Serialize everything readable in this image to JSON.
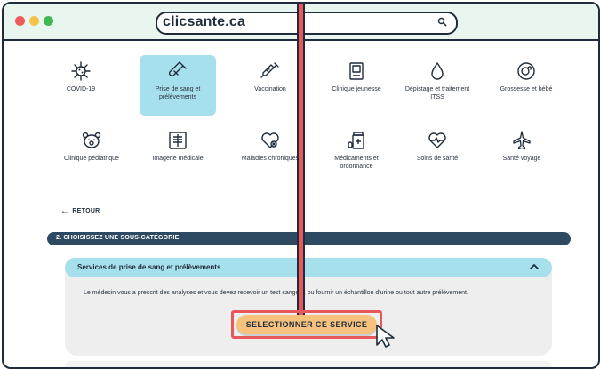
{
  "browser": {
    "url": "clicsante.ca"
  },
  "categories": [
    {
      "label": "COVID-19",
      "icon": "virus-icon"
    },
    {
      "label": "Prise de sang et prélèvements",
      "icon": "test-tube-icon",
      "selected": true
    },
    {
      "label": "Vaccination",
      "icon": "syringe-icon"
    },
    {
      "label": "Clinique jeunesse",
      "icon": "clipboard-icon"
    },
    {
      "label": "Dépistage et traitement ITSS",
      "icon": "drop-icon"
    },
    {
      "label": "Grossesse et bébé",
      "icon": "baby-icon"
    },
    {
      "label": "Clinique pédiatrique",
      "icon": "teddy-bear-icon"
    },
    {
      "label": "Imagerie médicale",
      "icon": "xray-icon"
    },
    {
      "label": "Maladies chroniques",
      "icon": "heart-icon"
    },
    {
      "label": "Médicaments et ordonnance",
      "icon": "pill-bottle-icon"
    },
    {
      "label": "Soins de santé",
      "icon": "heartbeat-icon"
    },
    {
      "label": "Santé voyage",
      "icon": "airplane-icon"
    }
  ],
  "back_label": "RETOUR",
  "step_title": "2. CHOISISSEZ UNE SOUS-CATÉGORIE",
  "subcategory": {
    "title": "Services de prise de sang et prélèvements",
    "description": "Le médecin vous a prescrit des analyses et vous devez recevoir un test sanguin, ou fournir un échantillon d'urine ou tout autre prélèvement.",
    "button_label": "SELECTIONNER CE SERVICE"
  },
  "colors": {
    "accent": "#a6e0ec",
    "highlight": "#e8585b",
    "button": "#f6c27e",
    "stepbar": "#2e4a63"
  }
}
